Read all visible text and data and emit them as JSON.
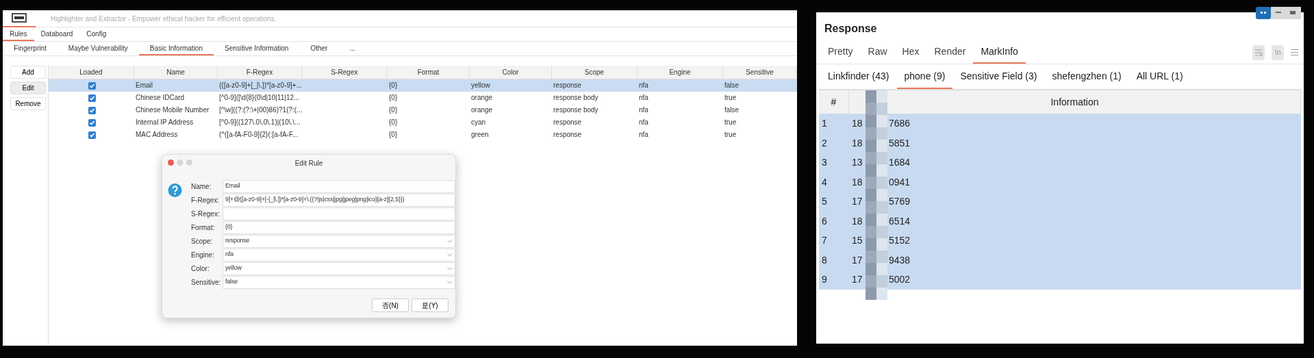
{
  "window": {
    "title": "Highlighter and Extractor - Empower ethical hacker for efficient operations."
  },
  "menu_tabs": [
    {
      "label": "Rules",
      "selected": true
    },
    {
      "label": "Databoard",
      "selected": false
    },
    {
      "label": "Config",
      "selected": false
    }
  ],
  "sub_tabs": [
    {
      "label": "Fingerprint",
      "selected": false
    },
    {
      "label": "Maybe Vulnerability",
      "selected": false
    },
    {
      "label": "Basic Information",
      "selected": true
    },
    {
      "label": "Sensitive Information",
      "selected": false
    },
    {
      "label": "Other",
      "selected": false
    },
    {
      "label": "...",
      "selected": false
    }
  ],
  "side_buttons": [
    {
      "label": "Add",
      "pressed": false
    },
    {
      "label": "Edit",
      "pressed": true
    },
    {
      "label": "Remove",
      "pressed": false
    }
  ],
  "rules_table": {
    "columns": [
      "Loaded",
      "Name",
      "F-Regex",
      "S-Regex",
      "Format",
      "Color",
      "Scope",
      "Engine",
      "Sensitive"
    ],
    "rows": [
      {
        "selected": true,
        "loaded": true,
        "name": "Email",
        "f_regex": "(([a-z0-9]+[_|\\.])*[a-z0-9]+...",
        "format": "{0}",
        "color_name": "yellow",
        "scope": "response",
        "engine": "nfa",
        "sensitive": "false"
      },
      {
        "selected": false,
        "loaded": true,
        "name": "Chinese IDCard",
        "f_regex": "[^0-9]([\\d{8}(0\\d|10|11|12...",
        "format": "{0}",
        "color_name": "orange",
        "scope": "response body",
        "engine": "nfa",
        "sensitive": "true"
      },
      {
        "selected": false,
        "loaded": true,
        "name": "Chinese Mobile Number",
        "f_regex": "[^\\w]((?:(?:\\+|00)86)?1(?:(...",
        "format": "{0}",
        "color_name": "orange",
        "scope": "response body",
        "engine": "nfa",
        "sensitive": "false"
      },
      {
        "selected": false,
        "loaded": true,
        "name": "Internal IP Address",
        "f_regex": "[^0-9]((127\\.0\\.0\\.1)|(10\\.\\...",
        "format": "{0}",
        "color_name": "cyan",
        "scope": "response",
        "engine": "nfa",
        "sensitive": "true"
      },
      {
        "selected": false,
        "loaded": true,
        "name": "MAC Address",
        "f_regex": "(^([a-fA-F0-9]{2}(:[a-fA-F...",
        "format": "{0}",
        "color_name": "green",
        "scope": "response",
        "engine": "nfa",
        "sensitive": "true"
      }
    ]
  },
  "dialog": {
    "title": "Edit Rule",
    "fields": [
      {
        "label": "Name:",
        "kind": "text",
        "value": "Email"
      },
      {
        "label": "F-Regex:",
        "kind": "text",
        "value": "9]+@([a-z0-9]+[-|_|\\.])*[a-z0-9]+\\.((?!js|css|jpg|jpeg|png|ico)[a-z]{2,5}))"
      },
      {
        "label": "S-Regex:",
        "kind": "text"
      },
      {
        "label": "Format:",
        "kind": "text",
        "value": "{0}"
      },
      {
        "label": "Scope:",
        "kind": "select",
        "value": "response"
      },
      {
        "label": "Engine:",
        "kind": "select",
        "value": "nfa"
      },
      {
        "label": "Color:",
        "kind": "select",
        "value": "yellow"
      },
      {
        "label": "Sensitive:",
        "kind": "select",
        "value": "false"
      }
    ],
    "buttons": [
      "否(N)",
      "是(Y)"
    ]
  },
  "response": {
    "title": "Response",
    "view_tabs": [
      {
        "label": "Pretty",
        "selected": false
      },
      {
        "label": "Raw",
        "selected": false
      },
      {
        "label": "Hex",
        "selected": false
      },
      {
        "label": "Render",
        "selected": false
      },
      {
        "label": "MarkInfo",
        "selected": true
      }
    ],
    "newline_toggle": "\\n",
    "result_tabs": [
      {
        "label": "Linkfinder (43)",
        "selected": false
      },
      {
        "label": "phone (9)",
        "selected": true
      },
      {
        "label": "Sensitive Field (3)",
        "selected": false
      },
      {
        "label": "shefengzhen (1)",
        "selected": false
      },
      {
        "label": "All URL (1)",
        "selected": false
      }
    ],
    "columns": [
      "#",
      "Information"
    ],
    "rows": [
      {
        "index": "1",
        "prefix": "18",
        "suffix": "7686",
        "selected": true
      },
      {
        "index": "2",
        "prefix": "18",
        "suffix": "5851",
        "selected": true
      },
      {
        "index": "3",
        "prefix": "13",
        "suffix": "1684",
        "selected": true
      },
      {
        "index": "4",
        "prefix": "18",
        "suffix": "0941",
        "selected": true
      },
      {
        "index": "5",
        "prefix": "17",
        "suffix": "5769",
        "selected": true
      },
      {
        "index": "6",
        "prefix": "18",
        "suffix": "6514",
        "selected": true
      },
      {
        "index": "7",
        "prefix": "15",
        "suffix": "5152",
        "selected": true
      },
      {
        "index": "8",
        "prefix": "17",
        "suffix": "9438",
        "selected": true
      },
      {
        "index": "9",
        "prefix": "17",
        "suffix": "5002",
        "selected": true
      }
    ]
  }
}
